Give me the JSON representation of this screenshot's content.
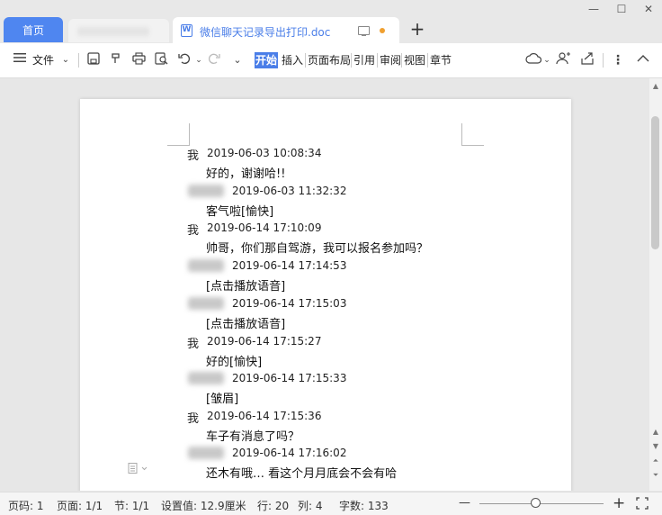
{
  "tabs": {
    "home": "首页",
    "doc_title": "微信聊天记录导出打印.doc",
    "new_tab": "+",
    "doc_icon": "W"
  },
  "window": {
    "minimize": "—",
    "maximize": "☐",
    "close": "✕"
  },
  "toolbar": {
    "file_label": "文件",
    "menu_tabs": [
      "开始",
      "插入",
      "页面布局",
      "引用",
      "审阅",
      "视图",
      "章节"
    ],
    "active_tab": "开始",
    "icons": [
      "hamburger-icon",
      "save-icon",
      "format-painter-icon",
      "print-icon",
      "print-preview-icon",
      "undo-icon",
      "redo-icon",
      "more-dropdown-icon",
      "cloud-icon",
      "share-user-icon",
      "share-icon",
      "more-icon",
      "collapse-icon"
    ]
  },
  "messages": [
    {
      "sender": "我",
      "time": "2019-06-03 10:08:34",
      "text": "好的，谢谢哈!!"
    },
    {
      "sender": "",
      "time": "2019-06-03 11:32:32",
      "text": "客气啦[愉快]"
    },
    {
      "sender": "我",
      "time": "2019-06-14 17:10:09",
      "text": "帅哥，你们那自驾游，我可以报名参加吗？"
    },
    {
      "sender": "",
      "time": "2019-06-14 17:14:53",
      "text": "[点击播放语音]"
    },
    {
      "sender": "",
      "time": "2019-06-14 17:15:03",
      "text": "[点击播放语音]"
    },
    {
      "sender": "我",
      "time": "2019-06-14 17:15:27",
      "text": "好的[愉快]"
    },
    {
      "sender": "",
      "time": "2019-06-14 17:15:33",
      "text": "[皱眉]"
    },
    {
      "sender": "我",
      "time": "2019-06-14 17:15:36",
      "text": "车子有消息了吗？"
    },
    {
      "sender": "",
      "time": "2019-06-14 17:16:02",
      "text": "还木有哦… 看这个月月底会不会有哈"
    }
  ],
  "status": {
    "page_num": "页码: 1",
    "pages": "页面: 1/1",
    "section": "节: 1/1",
    "setting": "设置值: 12.9厘米",
    "row": "行: 20",
    "col": "列: 4",
    "words": "字数: 133",
    "zoom_out": "—",
    "zoom_in": "+",
    "zoom_level": 0.45
  }
}
